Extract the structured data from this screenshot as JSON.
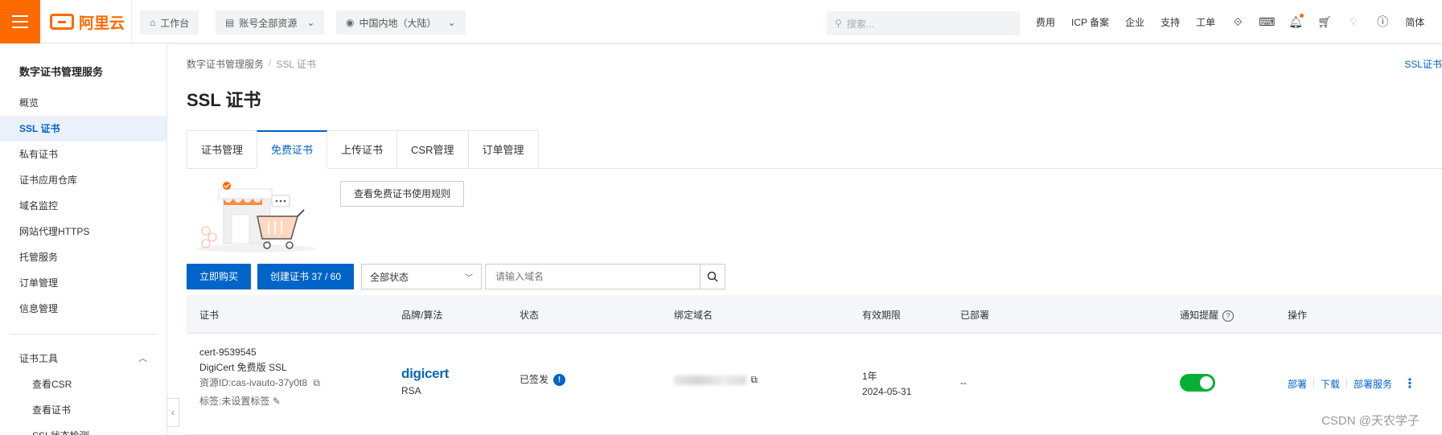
{
  "topbar": {
    "brand": "阿里云",
    "workbench": "工作台",
    "resources": "账号全部资源",
    "region": "中国内地（大陆）",
    "search_placeholder": "搜索...",
    "links": [
      "费用",
      "ICP 备案",
      "企业",
      "支持",
      "工单"
    ],
    "lang": "简体"
  },
  "sidebar": {
    "title": "数字证书管理服务",
    "items": [
      "概览",
      "SSL 证书",
      "私有证书",
      "证书应用仓库",
      "域名监控",
      "网站代理HTTPS",
      "托管服务",
      "订单管理",
      "信息管理"
    ],
    "tools_title": "证书工具",
    "tools_items": [
      "查看CSR",
      "查看证书",
      "SSL状态检测"
    ]
  },
  "main": {
    "breadcrumb": [
      "数字证书管理服务",
      "SSL 证书"
    ],
    "toplink": "SSL证书",
    "title": "SSL 证书",
    "tabs": [
      "证书管理",
      "免费证书",
      "上传证书",
      "CSR管理",
      "订单管理"
    ],
    "rules_button": "查看免费证书使用规则",
    "buy_button": "立即购买",
    "create_button": "创建证书 37 / 60",
    "status_select": "全部状态",
    "domain_placeholder": "请输入域名"
  },
  "table": {
    "headers": [
      "证书",
      "品牌/算法",
      "状态",
      "绑定域名",
      "有效期限",
      "已部署",
      "通知提醒",
      "操作"
    ],
    "rows": [
      {
        "cert_name": "cert-9539545",
        "cert_type": "DigiCert 免费版 SSL",
        "resource_id": "资源ID:cas-ivauto-37y0t8",
        "tag": "标签:未设置标签",
        "brand": "digicert",
        "algorithm": "RSA",
        "status": "已签发",
        "validity": "1年",
        "expire": "2024-05-31",
        "deployed": "--",
        "ops": [
          "部署",
          "下载",
          "部署服务"
        ]
      }
    ]
  },
  "watermark": "CSDN @天农学子",
  "colors": {
    "accent": "#0064c8",
    "brand": "#ff6a00",
    "toggle_on": "#06b035"
  }
}
